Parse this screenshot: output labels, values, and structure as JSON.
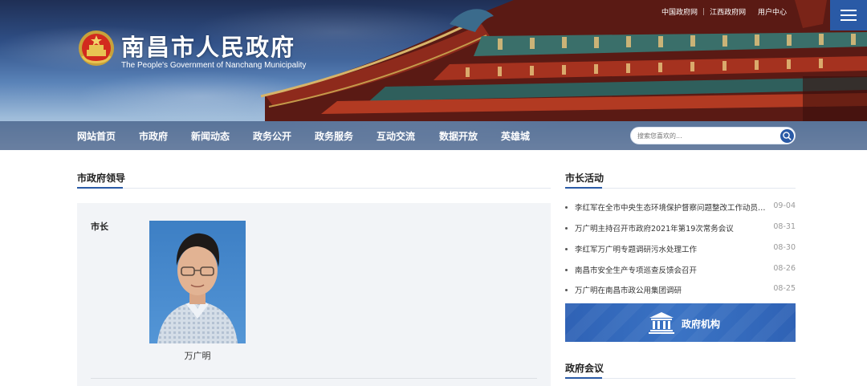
{
  "site": {
    "title": "南昌市人民政府",
    "subtitle": "The People's Government of Nanchang Municipality"
  },
  "top_links": {
    "items": [
      "中国政府网",
      "江西政府网",
      "用户中心"
    ]
  },
  "nav": {
    "items": [
      {
        "label": "网站首页",
        "active": false
      },
      {
        "label": "市政府",
        "active": true
      },
      {
        "label": "新闻动态",
        "active": false
      },
      {
        "label": "政务公开",
        "active": false
      },
      {
        "label": "政务服务",
        "active": false
      },
      {
        "label": "互动交流",
        "active": false
      },
      {
        "label": "数据开放",
        "active": false
      },
      {
        "label": "英雄城",
        "active": false
      }
    ]
  },
  "search": {
    "placeholder": "搜索您喜欢的..."
  },
  "leaders": {
    "heading": "市政府领导",
    "role": "市长",
    "name": "万广明"
  },
  "activities": {
    "heading": "市长活动",
    "items": [
      {
        "title": "李红军在全市中央生态环境保护督察问题整改工作动员部...",
        "date": "09-04"
      },
      {
        "title": "万广明主持召开市政府2021年第19次常务会议",
        "date": "08-31"
      },
      {
        "title": "李红军万广明专题调研污水处理工作",
        "date": "08-30"
      },
      {
        "title": "南昌市安全生产专项巡查反馈会召开",
        "date": "08-26"
      },
      {
        "title": "万广明在南昌市政公用集团调研",
        "date": "08-25"
      }
    ]
  },
  "org_banner": {
    "label": "政府机构"
  },
  "meetings": {
    "heading": "政府会议"
  },
  "colors": {
    "accent": "#2a5aa6",
    "org_banner": "#3a73c4",
    "panel_bg": "#f2f4f7"
  },
  "icons": {
    "menu": "hamburger-menu-icon",
    "search": "magnifier-icon",
    "emblem": "national-emblem-icon",
    "org": "government-building-icon"
  }
}
